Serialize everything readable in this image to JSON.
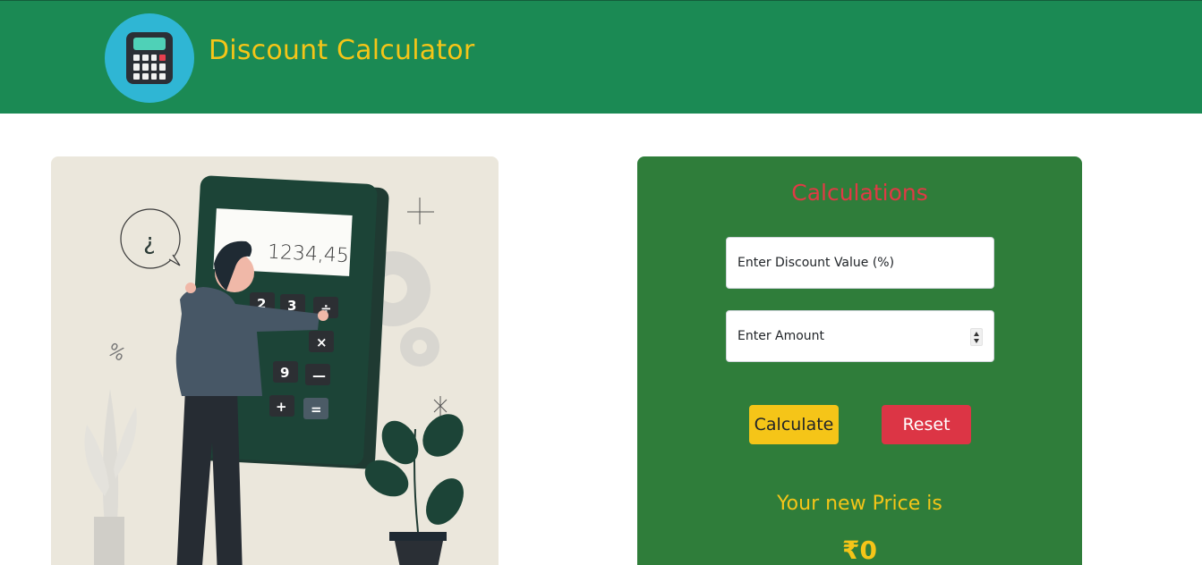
{
  "header": {
    "title": "Discount Calculator",
    "logo_icon": "calculator-icon",
    "bg_color": "#1b8a54",
    "title_color": "#f5c518"
  },
  "illustration": {
    "screen_text": "1234,45",
    "speech_bubble": "¿",
    "percent_doodle": "%",
    "keys": [
      "2",
      "3",
      "÷",
      "×",
      "9",
      "—",
      "+",
      "="
    ]
  },
  "calculator": {
    "title": "Calculations",
    "discount": {
      "placeholder": "Enter Discount Value (%)",
      "value": ""
    },
    "amount": {
      "placeholder": "Enter Amount",
      "value": ""
    },
    "calculate_label": "Calculate",
    "reset_label": "Reset",
    "result_label": "Your new Price is",
    "result_value": "₹0",
    "card_color": "#2f7d3a",
    "title_color": "#e03a45"
  }
}
